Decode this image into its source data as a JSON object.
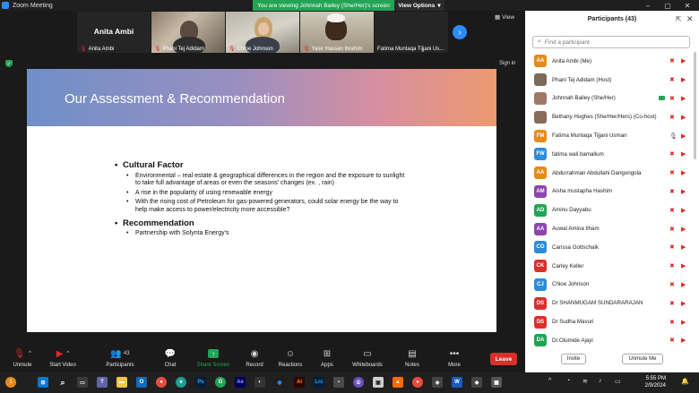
{
  "window": {
    "title": "Zoom Meeting",
    "viewing_banner": "You are viewing Johnnah Bailey (She/Her)'s screen",
    "view_options_label": "View Options",
    "view_label": "View",
    "sign_in_label": "Sign in"
  },
  "thumbnails": [
    {
      "name": "Anita Ambi",
      "big_name": "Anita Ambi"
    },
    {
      "name": "Phani Tej Adidam"
    },
    {
      "name": "Chloe Johnson"
    },
    {
      "name": "Yasir Hassan Ibrahim"
    },
    {
      "name": "Fatima Muntaqa Tijjani Us..."
    }
  ],
  "slide": {
    "title": "Our Assessment & Recommendation",
    "sections": [
      {
        "heading": "Cultural Factor",
        "bullets": [
          "Environmental – real estate & geographical differences in the region and the exposure to sunlight to take full advantage of areas or even the seasons' changes (ex. , rain)",
          "A rise in the popularity of using renewable energy",
          "With the rising cost of Petroleum for gas-powered generators, could solar energy be the way to help make access to power/electricity more accessible?"
        ]
      },
      {
        "heading": "Recommendation",
        "bullets": [
          "Partnership with Solynta Energy's"
        ]
      }
    ]
  },
  "toolbar": {
    "unmute": "Unmute",
    "start_video": "Start Video",
    "participants": "Participants",
    "participants_count": "43",
    "chat": "Chat",
    "share_screen": "Share Screen",
    "record": "Record",
    "reactions": "Reactions",
    "apps": "Apps",
    "whiteboards": "Whiteboards",
    "notes": "Notes",
    "more": "More",
    "leave": "Leave"
  },
  "panel": {
    "title": "Participants (43)",
    "search_placeholder": "Find a participant",
    "invite": "Invite",
    "unmute_me": "Unmute Me",
    "participants": [
      {
        "initials": "AA",
        "name": "Anita Ambi (Me)",
        "color": "#e8891c"
      },
      {
        "initials": "",
        "name": "Phani Tej Adidam (Host)",
        "color": "#7a6a5a",
        "photo": true
      },
      {
        "initials": "",
        "name": "Johnnah Bailey (She/Her)",
        "color": "#a07868",
        "photo": true,
        "sharing": true
      },
      {
        "initials": "",
        "name": "Bethany Hughes (She/Her/Hers) (Co-host)",
        "color": "#8a6a58",
        "photo": true
      },
      {
        "initials": "FM",
        "name": "Fatima Muntaqa Tijjani Usman",
        "color": "#e8891c"
      },
      {
        "initials": "FW",
        "name": "fatima wali bamallum",
        "color": "#2d8cd8"
      },
      {
        "initials": "AA",
        "name": "Abdurrahman Abdullahi Dangongola",
        "color": "#e8891c"
      },
      {
        "initials": "AM",
        "name": "Aisha mustapha Hashim",
        "color": "#8e44ad"
      },
      {
        "initials": "AD",
        "name": "Aminu Dayyabu",
        "color": "#23a455"
      },
      {
        "initials": "AA",
        "name": "Auwal Amina Ilham",
        "color": "#8e44ad"
      },
      {
        "initials": "CG",
        "name": "Carissa Gottschalk",
        "color": "#2d8cd8"
      },
      {
        "initials": "CK",
        "name": "Carley Keller",
        "color": "#d9302c"
      },
      {
        "initials": "CJ",
        "name": "Chloe Johnson",
        "color": "#2d8cd8"
      },
      {
        "initials": "DS",
        "name": "Dr SHANMUGAM SUNDARARAJAN",
        "color": "#d9302c"
      },
      {
        "initials": "DS",
        "name": "Dr Sudha Mavuri",
        "color": "#d9302c"
      },
      {
        "initials": "DA",
        "name": "Dr.Olumide Ajayi",
        "color": "#23a455"
      }
    ]
  },
  "taskbar": {
    "weather_badge": "1",
    "time": "5:55 PM",
    "date": "2/9/2024"
  }
}
